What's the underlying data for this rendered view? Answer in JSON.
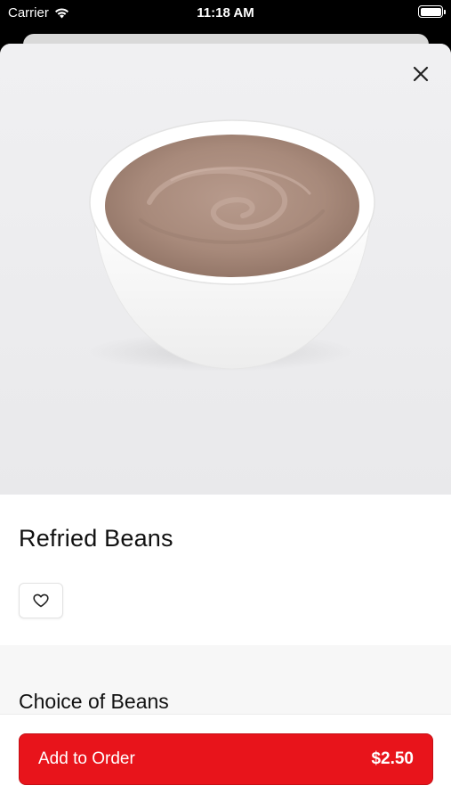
{
  "status_bar": {
    "carrier": "Carrier",
    "time": "11:18 AM",
    "icons": [
      "wifi-icon",
      "battery-icon"
    ]
  },
  "item": {
    "title": "Refried Beans",
    "image": "bowl-of-refried-beans"
  },
  "actions": {
    "close_icon": "close-icon",
    "favorite_icon": "heart-icon"
  },
  "options": {
    "section_title": "Choice of Beans"
  },
  "footer": {
    "button_label": "Add to Order",
    "price": "$2.50"
  },
  "colors": {
    "accent": "#e8141b",
    "sheet_background": "#ffffff",
    "section_background": "#f7f7f7"
  }
}
